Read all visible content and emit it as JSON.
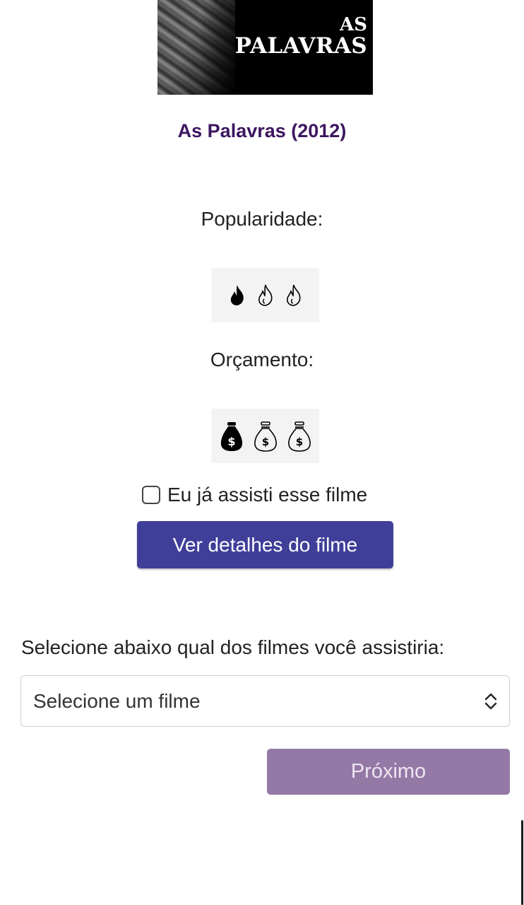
{
  "poster": {
    "line1": "AS",
    "line2": "PALAVRAS"
  },
  "movie": {
    "title": "As Palavras (2012)"
  },
  "popularity": {
    "label": "Popularidade:",
    "level": 1,
    "max": 3,
    "icon": "fire-icon"
  },
  "budget": {
    "label": "Orçamento:",
    "level": 1,
    "max": 3,
    "icon": "money-bag-icon"
  },
  "watched": {
    "label": "Eu já assisti esse filme",
    "checked": false
  },
  "details_button": {
    "label": "Ver detalhes do filme"
  },
  "selection": {
    "prompt": "Selecione abaixo qual dos filmes você assistiria:",
    "selected": "Selecione um filme"
  },
  "next_button": {
    "label": "Próximo"
  },
  "colors": {
    "title": "#3d1660",
    "primary_button": "#3f3f99",
    "next_button_disabled": "#9479a6"
  }
}
